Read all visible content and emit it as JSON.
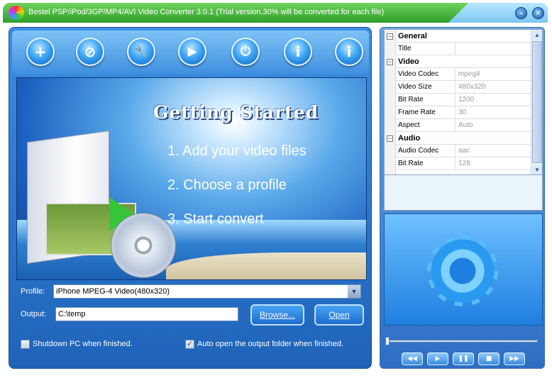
{
  "window": {
    "title": "Bestel PSP/iPod/3GP/MP4/AVI Video Converter 3.0.1 (Trial version,30% will be converted for each file)",
    "minimize_glyph": "–",
    "close_glyph": "✕"
  },
  "toolbar": {
    "buttons": [
      {
        "name": "add-file-button",
        "icon": "plus-icon",
        "glyph": "+"
      },
      {
        "name": "remove-button",
        "icon": "no-icon",
        "glyph": "⊘"
      },
      {
        "name": "settings-button",
        "icon": "wrench-icon",
        "glyph": "🔧"
      },
      {
        "name": "convert-button",
        "icon": "play-icon",
        "glyph": "▶"
      },
      {
        "name": "power-button",
        "icon": "power-icon",
        "glyph": "⏻"
      },
      {
        "name": "user-button",
        "icon": "person-icon",
        "glyph": "i"
      },
      {
        "name": "info-button",
        "icon": "info-icon",
        "glyph": "i"
      }
    ]
  },
  "banner": {
    "title": "Getting Started",
    "steps": [
      "1. Add your video files",
      "2. Choose a profile",
      "3. Start convert"
    ]
  },
  "profile": {
    "label": "Profile:",
    "value": "iPhone MPEG-4 Video(480x320)"
  },
  "output": {
    "label": "Output:",
    "value": "C:\\temp"
  },
  "buttons": {
    "browse": "Browse...",
    "open": "Open"
  },
  "options": {
    "shutdown": {
      "label": "Shutdown PC when finished.",
      "checked": false
    },
    "auto_open": {
      "label": "Auto open the output folder when finished.",
      "checked": true
    }
  },
  "properties": {
    "groups": [
      {
        "name": "General",
        "rows": [
          {
            "key": "Title",
            "value": ""
          }
        ]
      },
      {
        "name": "Video",
        "rows": [
          {
            "key": "Video Codec",
            "value": "mpeg4"
          },
          {
            "key": "Video Size",
            "value": "480x320"
          },
          {
            "key": "Bit Rate",
            "value": "1200"
          },
          {
            "key": "Frame Rate",
            "value": "30"
          },
          {
            "key": "Aspect",
            "value": "Auto"
          }
        ]
      },
      {
        "name": "Audio",
        "rows": [
          {
            "key": "Audio Codec",
            "value": "aac"
          },
          {
            "key": "Bit Rate",
            "value": "128"
          }
        ]
      }
    ]
  },
  "player": {
    "buttons": [
      {
        "name": "rewind-button",
        "icon": "rewind-icon",
        "glyph": "◀◀"
      },
      {
        "name": "play-button",
        "icon": "play-icon",
        "glyph": "▶"
      },
      {
        "name": "pause-button",
        "icon": "pause-icon",
        "glyph": "❚❚"
      },
      {
        "name": "stop-button",
        "icon": "stop-icon",
        "glyph": "■"
      },
      {
        "name": "forward-button",
        "icon": "fast-forward-icon",
        "glyph": "▶▶"
      }
    ]
  },
  "colors": {
    "accent": "#1f63b9",
    "title_bar": "#2f9e2a"
  }
}
